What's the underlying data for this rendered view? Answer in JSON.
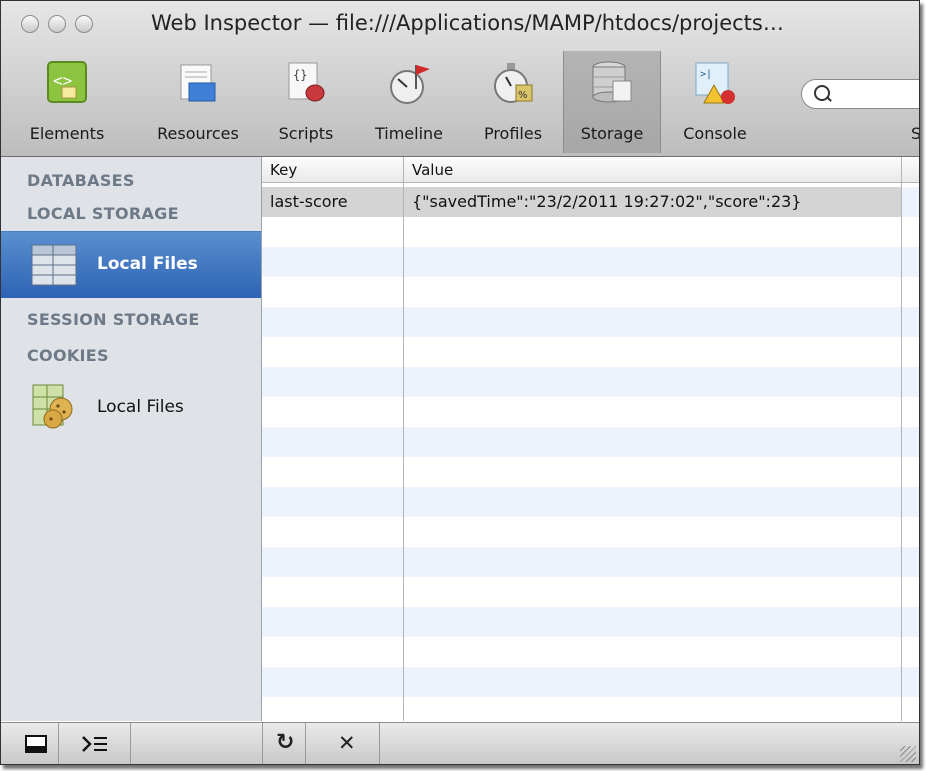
{
  "window": {
    "title": "Web Inspector — file:///Applications/MAMP/htdocs/projects…"
  },
  "toolbar": {
    "items": [
      {
        "label": "Elements"
      },
      {
        "label": "Resources"
      },
      {
        "label": "Scripts"
      },
      {
        "label": "Timeline"
      },
      {
        "label": "Profiles"
      },
      {
        "label": "Storage",
        "active": true
      },
      {
        "label": "Console"
      }
    ],
    "search_placeholder": "",
    "cut_label": "S"
  },
  "sidebar": {
    "databases": "DATABASES",
    "local_storage": "LOCAL STORAGE",
    "local_storage_item": "Local Files",
    "session_storage": "SESSION STORAGE",
    "cookies": "COOKIES",
    "cookies_item": "Local Files"
  },
  "table": {
    "columns": [
      "Key",
      "Value"
    ],
    "rows": [
      {
        "key": "last-score",
        "value": "{\"savedTime\":\"23/2/2011 19:27:02\",\"score\":23}"
      }
    ]
  },
  "statusbar": {
    "refresh_glyph": "↻",
    "delete_glyph": "✕"
  },
  "colors": {
    "selection_blue": "#2d63b3",
    "sidebar_bg": "#dfe3e8",
    "stripe": "#edf3fc"
  }
}
